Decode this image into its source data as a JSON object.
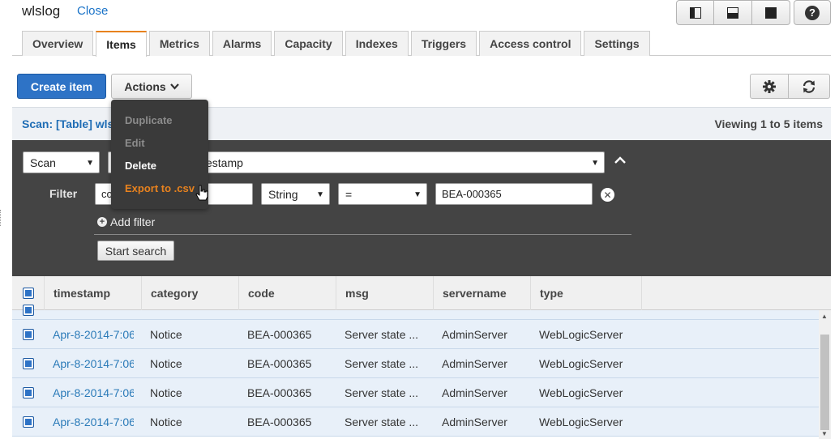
{
  "header": {
    "title": "wlslog",
    "close_label": "Close"
  },
  "view_buttons": [
    "split-left",
    "split-bottom",
    "full"
  ],
  "tabs": [
    {
      "label": "Overview"
    },
    {
      "label": "Items",
      "active": true
    },
    {
      "label": "Metrics"
    },
    {
      "label": "Alarms"
    },
    {
      "label": "Capacity"
    },
    {
      "label": "Indexes"
    },
    {
      "label": "Triggers"
    },
    {
      "label": "Access control"
    },
    {
      "label": "Settings"
    }
  ],
  "toolbar": {
    "create_label": "Create item",
    "actions_label": "Actions"
  },
  "actions_menu": {
    "items": [
      {
        "label": "Duplicate",
        "state": "disabled"
      },
      {
        "label": "Edit",
        "state": "disabled"
      },
      {
        "label": "Delete",
        "state": "enabled"
      },
      {
        "label": "Export to .csv",
        "state": "hover"
      }
    ]
  },
  "scan_bar": {
    "label": "Scan: [Table] wls",
    "viewing": "Viewing 1 to 5 items"
  },
  "query": {
    "mode": "Scan",
    "index": "estamp",
    "filter_label": "Filter",
    "attribute": "co",
    "type": "String",
    "operator": "=",
    "value": "BEA-000365",
    "add_filter_label": "Add filter",
    "start_label": "Start search"
  },
  "table": {
    "columns": [
      "timestamp",
      "category",
      "code",
      "msg",
      "servername",
      "type"
    ],
    "rows": [
      {
        "timestamp": "Apr-8-2014-7:06",
        "category": "Notice",
        "code": "BEA-000365",
        "msg": "Server state ...",
        "servername": "AdminServer",
        "type": "WebLogicServer"
      },
      {
        "timestamp": "Apr-8-2014-7:06",
        "category": "Notice",
        "code": "BEA-000365",
        "msg": "Server state ...",
        "servername": "AdminServer",
        "type": "WebLogicServer"
      },
      {
        "timestamp": "Apr-8-2014-7:06",
        "category": "Notice",
        "code": "BEA-000365",
        "msg": "Server state ...",
        "servername": "AdminServer",
        "type": "WebLogicServer"
      },
      {
        "timestamp": "Apr-8-2014-7:06",
        "category": "Notice",
        "code": "BEA-000365",
        "msg": "Server state ...",
        "servername": "AdminServer",
        "type": "WebLogicServer"
      }
    ]
  },
  "colors": {
    "accent": "#2e73c6",
    "tab_active": "#e8821e",
    "panel": "#444444",
    "menu": "#3a3a3a",
    "link": "#2a7ab8"
  }
}
